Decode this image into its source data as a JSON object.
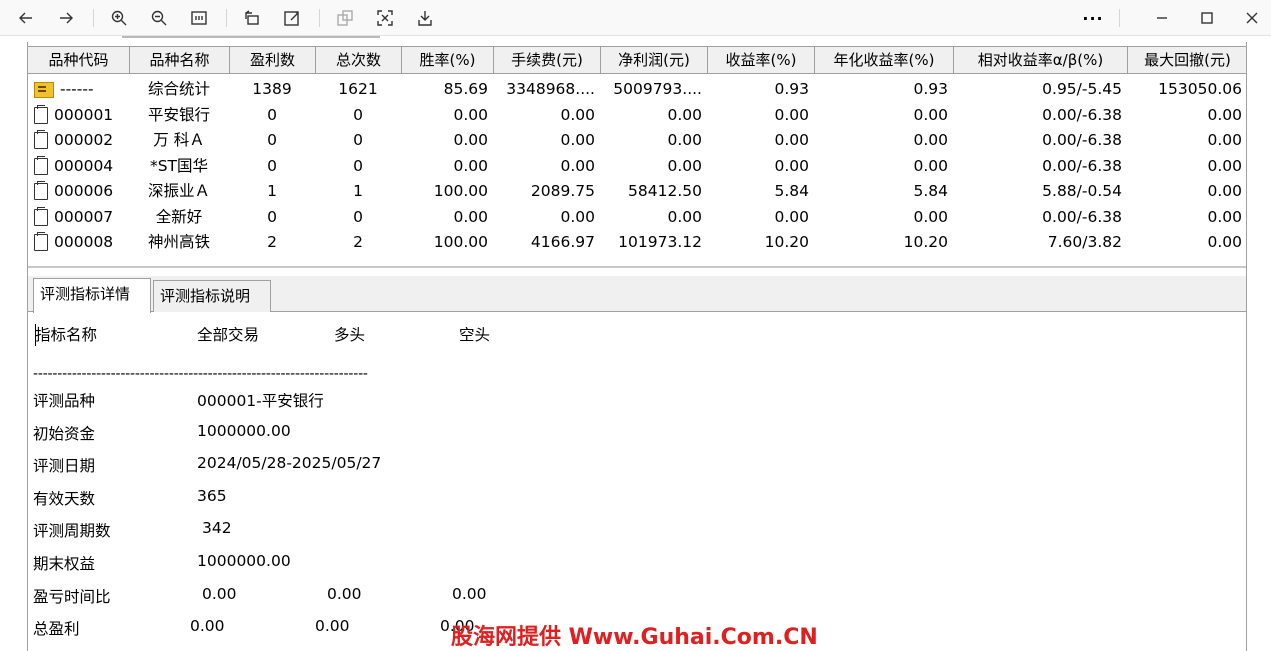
{
  "toolbar": {
    "buttons": [
      {
        "name": "back-icon"
      },
      {
        "name": "forward-icon"
      },
      {
        "name": "zoom-in-icon"
      },
      {
        "name": "zoom-out-icon"
      },
      {
        "name": "fit-width-icon"
      },
      {
        "name": "rotate-icon"
      },
      {
        "name": "edit-icon"
      },
      {
        "name": "copy-image-icon"
      },
      {
        "name": "crop-icon"
      },
      {
        "name": "save-icon"
      },
      {
        "name": "more-icon"
      },
      {
        "name": "minimize-icon"
      },
      {
        "name": "maximize-icon"
      },
      {
        "name": "close-icon"
      }
    ],
    "more_label": "···"
  },
  "grid": {
    "columns": [
      "品种代码",
      "品种名称",
      "盈利数",
      "总次数",
      "胜率(%)",
      "手续费(元)",
      "净利润(元)",
      "收益率(%)",
      "年化收益率(%)",
      "相对收益率α/β(%)",
      "最大回撤(元)"
    ],
    "rows": [
      {
        "icon": "summary",
        "code": "------",
        "name": "综合统计",
        "wins": "1389",
        "total": "1621",
        "win_rate": "85.69",
        "fee": "3348968....",
        "profit": "5009793....",
        "ret": "0.93",
        "annual": "0.93",
        "alpha_beta": "0.95/-5.45",
        "max_dd": "153050.06"
      },
      {
        "icon": "doc",
        "code": "000001",
        "name": "平安银行",
        "wins": "0",
        "total": "0",
        "win_rate": "0.00",
        "fee": "0.00",
        "profit": "0.00",
        "ret": "0.00",
        "annual": "0.00",
        "alpha_beta": "0.00/-6.38",
        "max_dd": "0.00"
      },
      {
        "icon": "doc",
        "code": "000002",
        "name": "万 科Ａ",
        "wins": "0",
        "total": "0",
        "win_rate": "0.00",
        "fee": "0.00",
        "profit": "0.00",
        "ret": "0.00",
        "annual": "0.00",
        "alpha_beta": "0.00/-6.38",
        "max_dd": "0.00"
      },
      {
        "icon": "doc",
        "code": "000004",
        "name": "*ST国华",
        "wins": "0",
        "total": "0",
        "win_rate": "0.00",
        "fee": "0.00",
        "profit": "0.00",
        "ret": "0.00",
        "annual": "0.00",
        "alpha_beta": "0.00/-6.38",
        "max_dd": "0.00"
      },
      {
        "icon": "doc",
        "code": "000006",
        "name": "深振业Ａ",
        "wins": "1",
        "total": "1",
        "win_rate": "100.00",
        "fee": "2089.75",
        "profit": "58412.50",
        "ret": "5.84",
        "annual": "5.84",
        "alpha_beta": "5.88/-0.54",
        "max_dd": "0.00"
      },
      {
        "icon": "doc",
        "code": "000007",
        "name": "全新好",
        "wins": "0",
        "total": "0",
        "win_rate": "0.00",
        "fee": "0.00",
        "profit": "0.00",
        "ret": "0.00",
        "annual": "0.00",
        "alpha_beta": "0.00/-6.38",
        "max_dd": "0.00"
      },
      {
        "icon": "doc",
        "code": "000008",
        "name": "神州高铁",
        "wins": "2",
        "total": "2",
        "win_rate": "100.00",
        "fee": "4166.97",
        "profit": "101973.12",
        "ret": "10.20",
        "annual": "10.20",
        "alpha_beta": "7.60/3.82",
        "max_dd": "0.00"
      }
    ]
  },
  "tabs": [
    "评测指标详情",
    "评测指标说明"
  ],
  "detail": {
    "header": {
      "name": "指标名称",
      "all": "全部交易",
      "long": "多头",
      "short": "空头"
    },
    "dashes": "---------------------------------------------------------------------",
    "items": [
      {
        "label": "评测品种",
        "v1": "000001-平安银行"
      },
      {
        "label": "初始资金",
        "v1": "1000000.00"
      },
      {
        "label": "评测日期",
        "v1": "2024/05/28-2025/05/27"
      },
      {
        "label": "有效天数",
        "v1": "365"
      },
      {
        "label": "评测周期数",
        "v1": "342"
      },
      {
        "label": "期末权益",
        "v1": "1000000.00"
      },
      {
        "label": "盈亏时间比",
        "v1": "0.00",
        "v2": "0.00",
        "v3": "0.00"
      },
      {
        "label": "总盈利",
        "v1": "0.00",
        "v2": "0.00",
        "v3": "0.00"
      }
    ]
  },
  "watermark": "股海网提供 Www.Guhai.Com.CN"
}
